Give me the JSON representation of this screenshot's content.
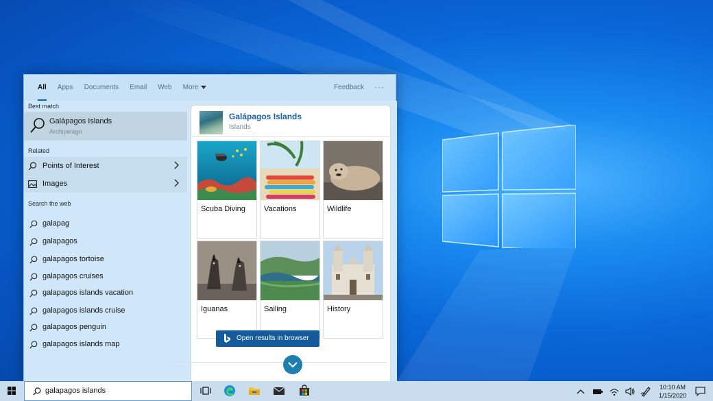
{
  "filter_bar": {
    "tabs": [
      "All",
      "Apps",
      "Documents",
      "Email",
      "Web",
      "More"
    ],
    "active_tab": "All",
    "feedback_label": "Feedback",
    "more_options_label": "···"
  },
  "left": {
    "best_match_label": "Best match",
    "best_match": {
      "title": "Galápagos Islands",
      "subtitle": "Archipelago",
      "icon": "search-icon"
    },
    "related_label": "Related",
    "related": [
      {
        "label": "Points of Interest",
        "icon": "search-icon"
      },
      {
        "label": "Images",
        "icon": "image-icon"
      }
    ],
    "web_label": "Search the web",
    "web_suggestions": [
      "galapag",
      "galapagos",
      "galapagos tortoise",
      "galapagos cruises",
      "galapagos islands vacation",
      "galapagos islands cruise",
      "galapagos penguin",
      "galapagos islands map"
    ]
  },
  "preview": {
    "title": "Galápagos Islands",
    "subtitle": "Islands",
    "tiles": [
      {
        "label": "Scuba Diving"
      },
      {
        "label": "Vacations"
      },
      {
        "label": "Wildlife"
      },
      {
        "label": "Iguanas"
      },
      {
        "label": "Sailing"
      },
      {
        "label": "History"
      }
    ],
    "open_browser_label": "Open results in browser"
  },
  "taskbar": {
    "search_value": "galapagos islands",
    "apps": [
      "task-view-icon",
      "edge-icon",
      "file-explorer-icon",
      "mail-icon",
      "store-icon"
    ],
    "clock_time": "10:10 AM",
    "clock_date": "1/15/2020"
  },
  "colors": {
    "accent": "#0067c0",
    "panel_bg": "#cfe7f8",
    "title_link": "#1a5fb4",
    "browser_button": "#155b9b"
  }
}
